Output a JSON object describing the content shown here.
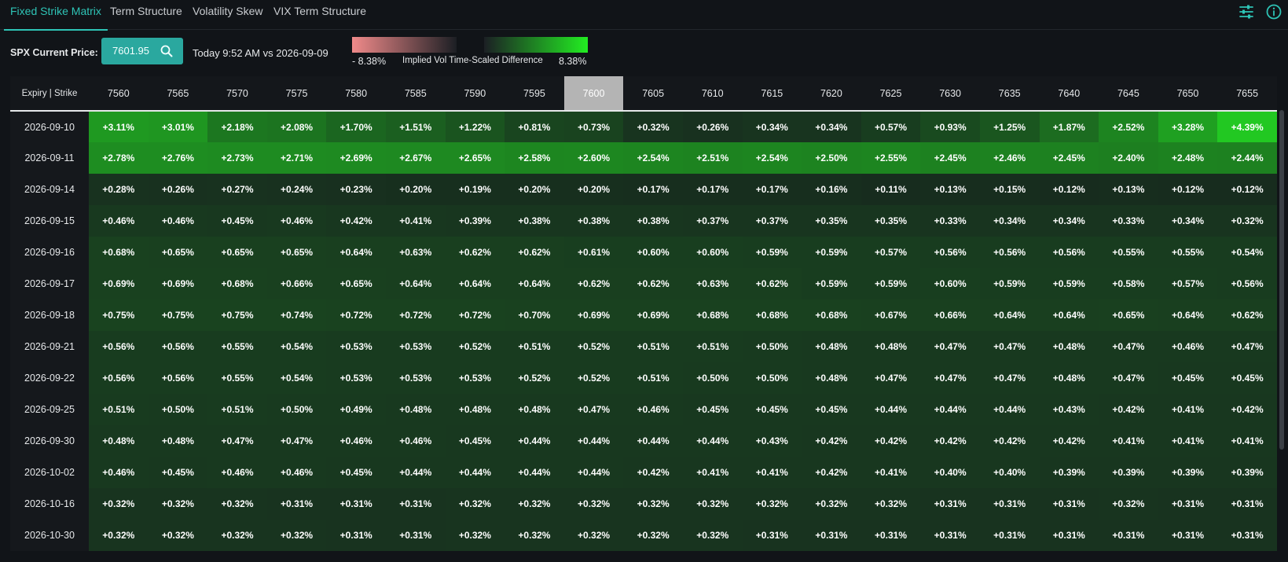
{
  "tabs": [
    {
      "label": "Fixed Strike Matrix",
      "active": true
    },
    {
      "label": "Term Structure",
      "active": false
    },
    {
      "label": "Volatility Skew",
      "active": false
    },
    {
      "label": "VIX Term Structure",
      "active": false
    }
  ],
  "header_icons": [
    "sliders-icon",
    "info-icon"
  ],
  "controls": {
    "price_label": "SPX Current Price:",
    "price_value": "7601.95",
    "compare_label": "Today 9:52 AM vs 2026-09-09",
    "legend_min": "- 8.38%",
    "legend_title": "Implied Vol Time-Scaled Difference",
    "legend_max": "8.38%",
    "legend_neg_color": "#f08a8a",
    "legend_pos_color": "#22ee22"
  },
  "colors": {
    "accent": "#2ec4b6",
    "background": "#111418",
    "atm_header": "#b4b4b4"
  },
  "table": {
    "corner_label": "Expiry | Strike",
    "atm_strike": "7600",
    "strikes": [
      "7560",
      "7565",
      "7570",
      "7575",
      "7580",
      "7585",
      "7590",
      "7595",
      "7600",
      "7605",
      "7610",
      "7615",
      "7620",
      "7625",
      "7630",
      "7635",
      "7640",
      "7645",
      "7650",
      "7655"
    ],
    "rows": [
      {
        "expiry": "2026-09-10",
        "values": [
          "+3.11%",
          "+3.01%",
          "+2.18%",
          "+2.08%",
          "+1.70%",
          "+1.51%",
          "+1.22%",
          "+0.81%",
          "+0.73%",
          "+0.32%",
          "+0.26%",
          "+0.34%",
          "+0.34%",
          "+0.57%",
          "+0.93%",
          "+1.25%",
          "+1.87%",
          "+2.52%",
          "+3.28%",
          "+4.39%"
        ]
      },
      {
        "expiry": "2026-09-11",
        "values": [
          "+2.78%",
          "+2.76%",
          "+2.73%",
          "+2.71%",
          "+2.69%",
          "+2.67%",
          "+2.65%",
          "+2.58%",
          "+2.60%",
          "+2.54%",
          "+2.51%",
          "+2.54%",
          "+2.50%",
          "+2.55%",
          "+2.45%",
          "+2.46%",
          "+2.45%",
          "+2.40%",
          "+2.48%",
          "+2.44%"
        ]
      },
      {
        "expiry": "2026-09-14",
        "values": [
          "+0.28%",
          "+0.26%",
          "+0.27%",
          "+0.24%",
          "+0.23%",
          "+0.20%",
          "+0.19%",
          "+0.20%",
          "+0.20%",
          "+0.17%",
          "+0.17%",
          "+0.17%",
          "+0.16%",
          "+0.11%",
          "+0.13%",
          "+0.15%",
          "+0.12%",
          "+0.13%",
          "+0.12%",
          "+0.12%"
        ]
      },
      {
        "expiry": "2026-09-15",
        "values": [
          "+0.46%",
          "+0.46%",
          "+0.45%",
          "+0.46%",
          "+0.42%",
          "+0.41%",
          "+0.39%",
          "+0.38%",
          "+0.38%",
          "+0.38%",
          "+0.37%",
          "+0.37%",
          "+0.35%",
          "+0.35%",
          "+0.33%",
          "+0.34%",
          "+0.34%",
          "+0.33%",
          "+0.34%",
          "+0.32%"
        ]
      },
      {
        "expiry": "2026-09-16",
        "values": [
          "+0.68%",
          "+0.65%",
          "+0.65%",
          "+0.65%",
          "+0.64%",
          "+0.63%",
          "+0.62%",
          "+0.62%",
          "+0.61%",
          "+0.60%",
          "+0.60%",
          "+0.59%",
          "+0.59%",
          "+0.57%",
          "+0.56%",
          "+0.56%",
          "+0.56%",
          "+0.55%",
          "+0.55%",
          "+0.54%"
        ]
      },
      {
        "expiry": "2026-09-17",
        "values": [
          "+0.69%",
          "+0.69%",
          "+0.68%",
          "+0.66%",
          "+0.65%",
          "+0.64%",
          "+0.64%",
          "+0.64%",
          "+0.62%",
          "+0.62%",
          "+0.63%",
          "+0.62%",
          "+0.59%",
          "+0.59%",
          "+0.60%",
          "+0.59%",
          "+0.59%",
          "+0.58%",
          "+0.57%",
          "+0.56%"
        ]
      },
      {
        "expiry": "2026-09-18",
        "values": [
          "+0.75%",
          "+0.75%",
          "+0.75%",
          "+0.74%",
          "+0.72%",
          "+0.72%",
          "+0.72%",
          "+0.70%",
          "+0.69%",
          "+0.69%",
          "+0.68%",
          "+0.68%",
          "+0.68%",
          "+0.67%",
          "+0.66%",
          "+0.64%",
          "+0.64%",
          "+0.65%",
          "+0.64%",
          "+0.62%"
        ]
      },
      {
        "expiry": "2026-09-21",
        "values": [
          "+0.56%",
          "+0.56%",
          "+0.55%",
          "+0.54%",
          "+0.53%",
          "+0.53%",
          "+0.52%",
          "+0.51%",
          "+0.52%",
          "+0.51%",
          "+0.51%",
          "+0.50%",
          "+0.48%",
          "+0.48%",
          "+0.47%",
          "+0.47%",
          "+0.48%",
          "+0.47%",
          "+0.46%",
          "+0.47%"
        ]
      },
      {
        "expiry": "2026-09-22",
        "values": [
          "+0.56%",
          "+0.56%",
          "+0.55%",
          "+0.54%",
          "+0.53%",
          "+0.53%",
          "+0.53%",
          "+0.52%",
          "+0.52%",
          "+0.51%",
          "+0.50%",
          "+0.50%",
          "+0.48%",
          "+0.47%",
          "+0.47%",
          "+0.47%",
          "+0.48%",
          "+0.47%",
          "+0.45%",
          "+0.45%"
        ]
      },
      {
        "expiry": "2026-09-25",
        "values": [
          "+0.51%",
          "+0.50%",
          "+0.51%",
          "+0.50%",
          "+0.49%",
          "+0.48%",
          "+0.48%",
          "+0.48%",
          "+0.47%",
          "+0.46%",
          "+0.45%",
          "+0.45%",
          "+0.45%",
          "+0.44%",
          "+0.44%",
          "+0.44%",
          "+0.43%",
          "+0.42%",
          "+0.41%",
          "+0.42%"
        ]
      },
      {
        "expiry": "2026-09-30",
        "values": [
          "+0.48%",
          "+0.48%",
          "+0.47%",
          "+0.47%",
          "+0.46%",
          "+0.46%",
          "+0.45%",
          "+0.44%",
          "+0.44%",
          "+0.44%",
          "+0.44%",
          "+0.43%",
          "+0.42%",
          "+0.42%",
          "+0.42%",
          "+0.42%",
          "+0.42%",
          "+0.41%",
          "+0.41%",
          "+0.41%"
        ]
      },
      {
        "expiry": "2026-10-02",
        "values": [
          "+0.46%",
          "+0.45%",
          "+0.46%",
          "+0.46%",
          "+0.45%",
          "+0.44%",
          "+0.44%",
          "+0.44%",
          "+0.44%",
          "+0.42%",
          "+0.41%",
          "+0.41%",
          "+0.42%",
          "+0.41%",
          "+0.40%",
          "+0.40%",
          "+0.39%",
          "+0.39%",
          "+0.39%",
          "+0.39%"
        ]
      },
      {
        "expiry": "2026-10-16",
        "values": [
          "+0.32%",
          "+0.32%",
          "+0.32%",
          "+0.31%",
          "+0.31%",
          "+0.31%",
          "+0.32%",
          "+0.32%",
          "+0.32%",
          "+0.32%",
          "+0.32%",
          "+0.32%",
          "+0.32%",
          "+0.32%",
          "+0.31%",
          "+0.31%",
          "+0.31%",
          "+0.32%",
          "+0.31%",
          "+0.31%"
        ]
      },
      {
        "expiry": "2026-10-30",
        "values": [
          "+0.32%",
          "+0.32%",
          "+0.32%",
          "+0.32%",
          "+0.31%",
          "+0.31%",
          "+0.32%",
          "+0.32%",
          "+0.32%",
          "+0.32%",
          "+0.32%",
          "+0.31%",
          "+0.31%",
          "+0.31%",
          "+0.31%",
          "+0.31%",
          "+0.31%",
          "+0.31%",
          "+0.31%",
          "+0.31%"
        ]
      }
    ]
  }
}
